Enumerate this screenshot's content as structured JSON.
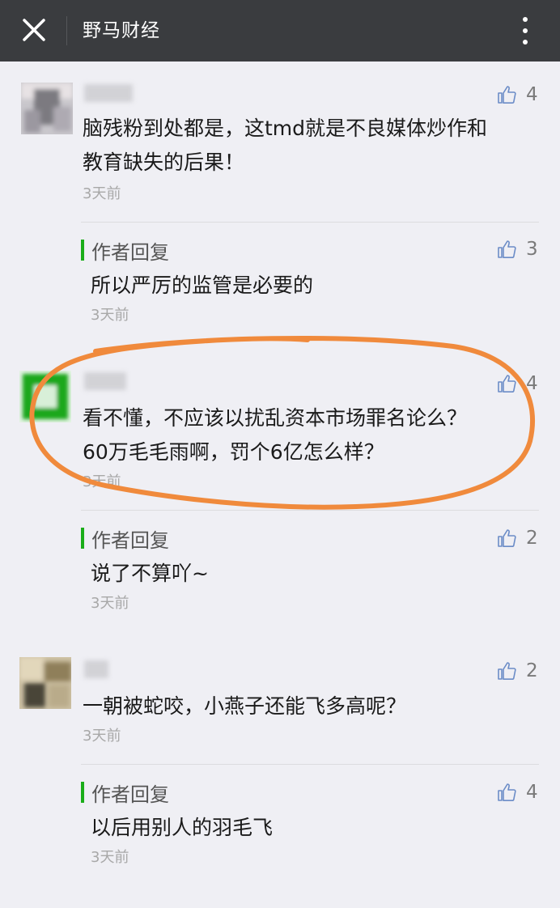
{
  "header": {
    "title": "野马财经",
    "close_icon": "close-icon",
    "more_icon": "more-vertical-icon",
    "bg_color": "#3a3c3f"
  },
  "reply_label": "作者回复",
  "like_icon": "thumbs-up-icon",
  "accent_color": "#1aad19",
  "annotation_color": "#f08a3c",
  "comments": [
    {
      "text_lines": [
        "脑残粉到处都是，这tmd就是不良媒体炒作和",
        "教育缺失的后果！"
      ],
      "time": "3天前",
      "likes": "4",
      "reply": {
        "text": "所以严厉的监管是必要的",
        "time": "3天前",
        "likes": "3"
      }
    },
    {
      "text_lines": [
        "看不懂，不应该以扰乱资本市场罪名论么？",
        "60万毛毛雨啊，罚个6亿怎么样？"
      ],
      "time": "3天前",
      "likes": "4",
      "reply": {
        "text": "说了不算吖~",
        "time": "3天前",
        "likes": "2"
      }
    },
    {
      "text_lines": [
        "一朝被蛇咬，小燕子还能飞多高呢？"
      ],
      "time": "3天前",
      "likes": "2",
      "reply": {
        "text": "以后用别人的羽毛飞",
        "time": "3天前",
        "likes": "4"
      }
    }
  ]
}
